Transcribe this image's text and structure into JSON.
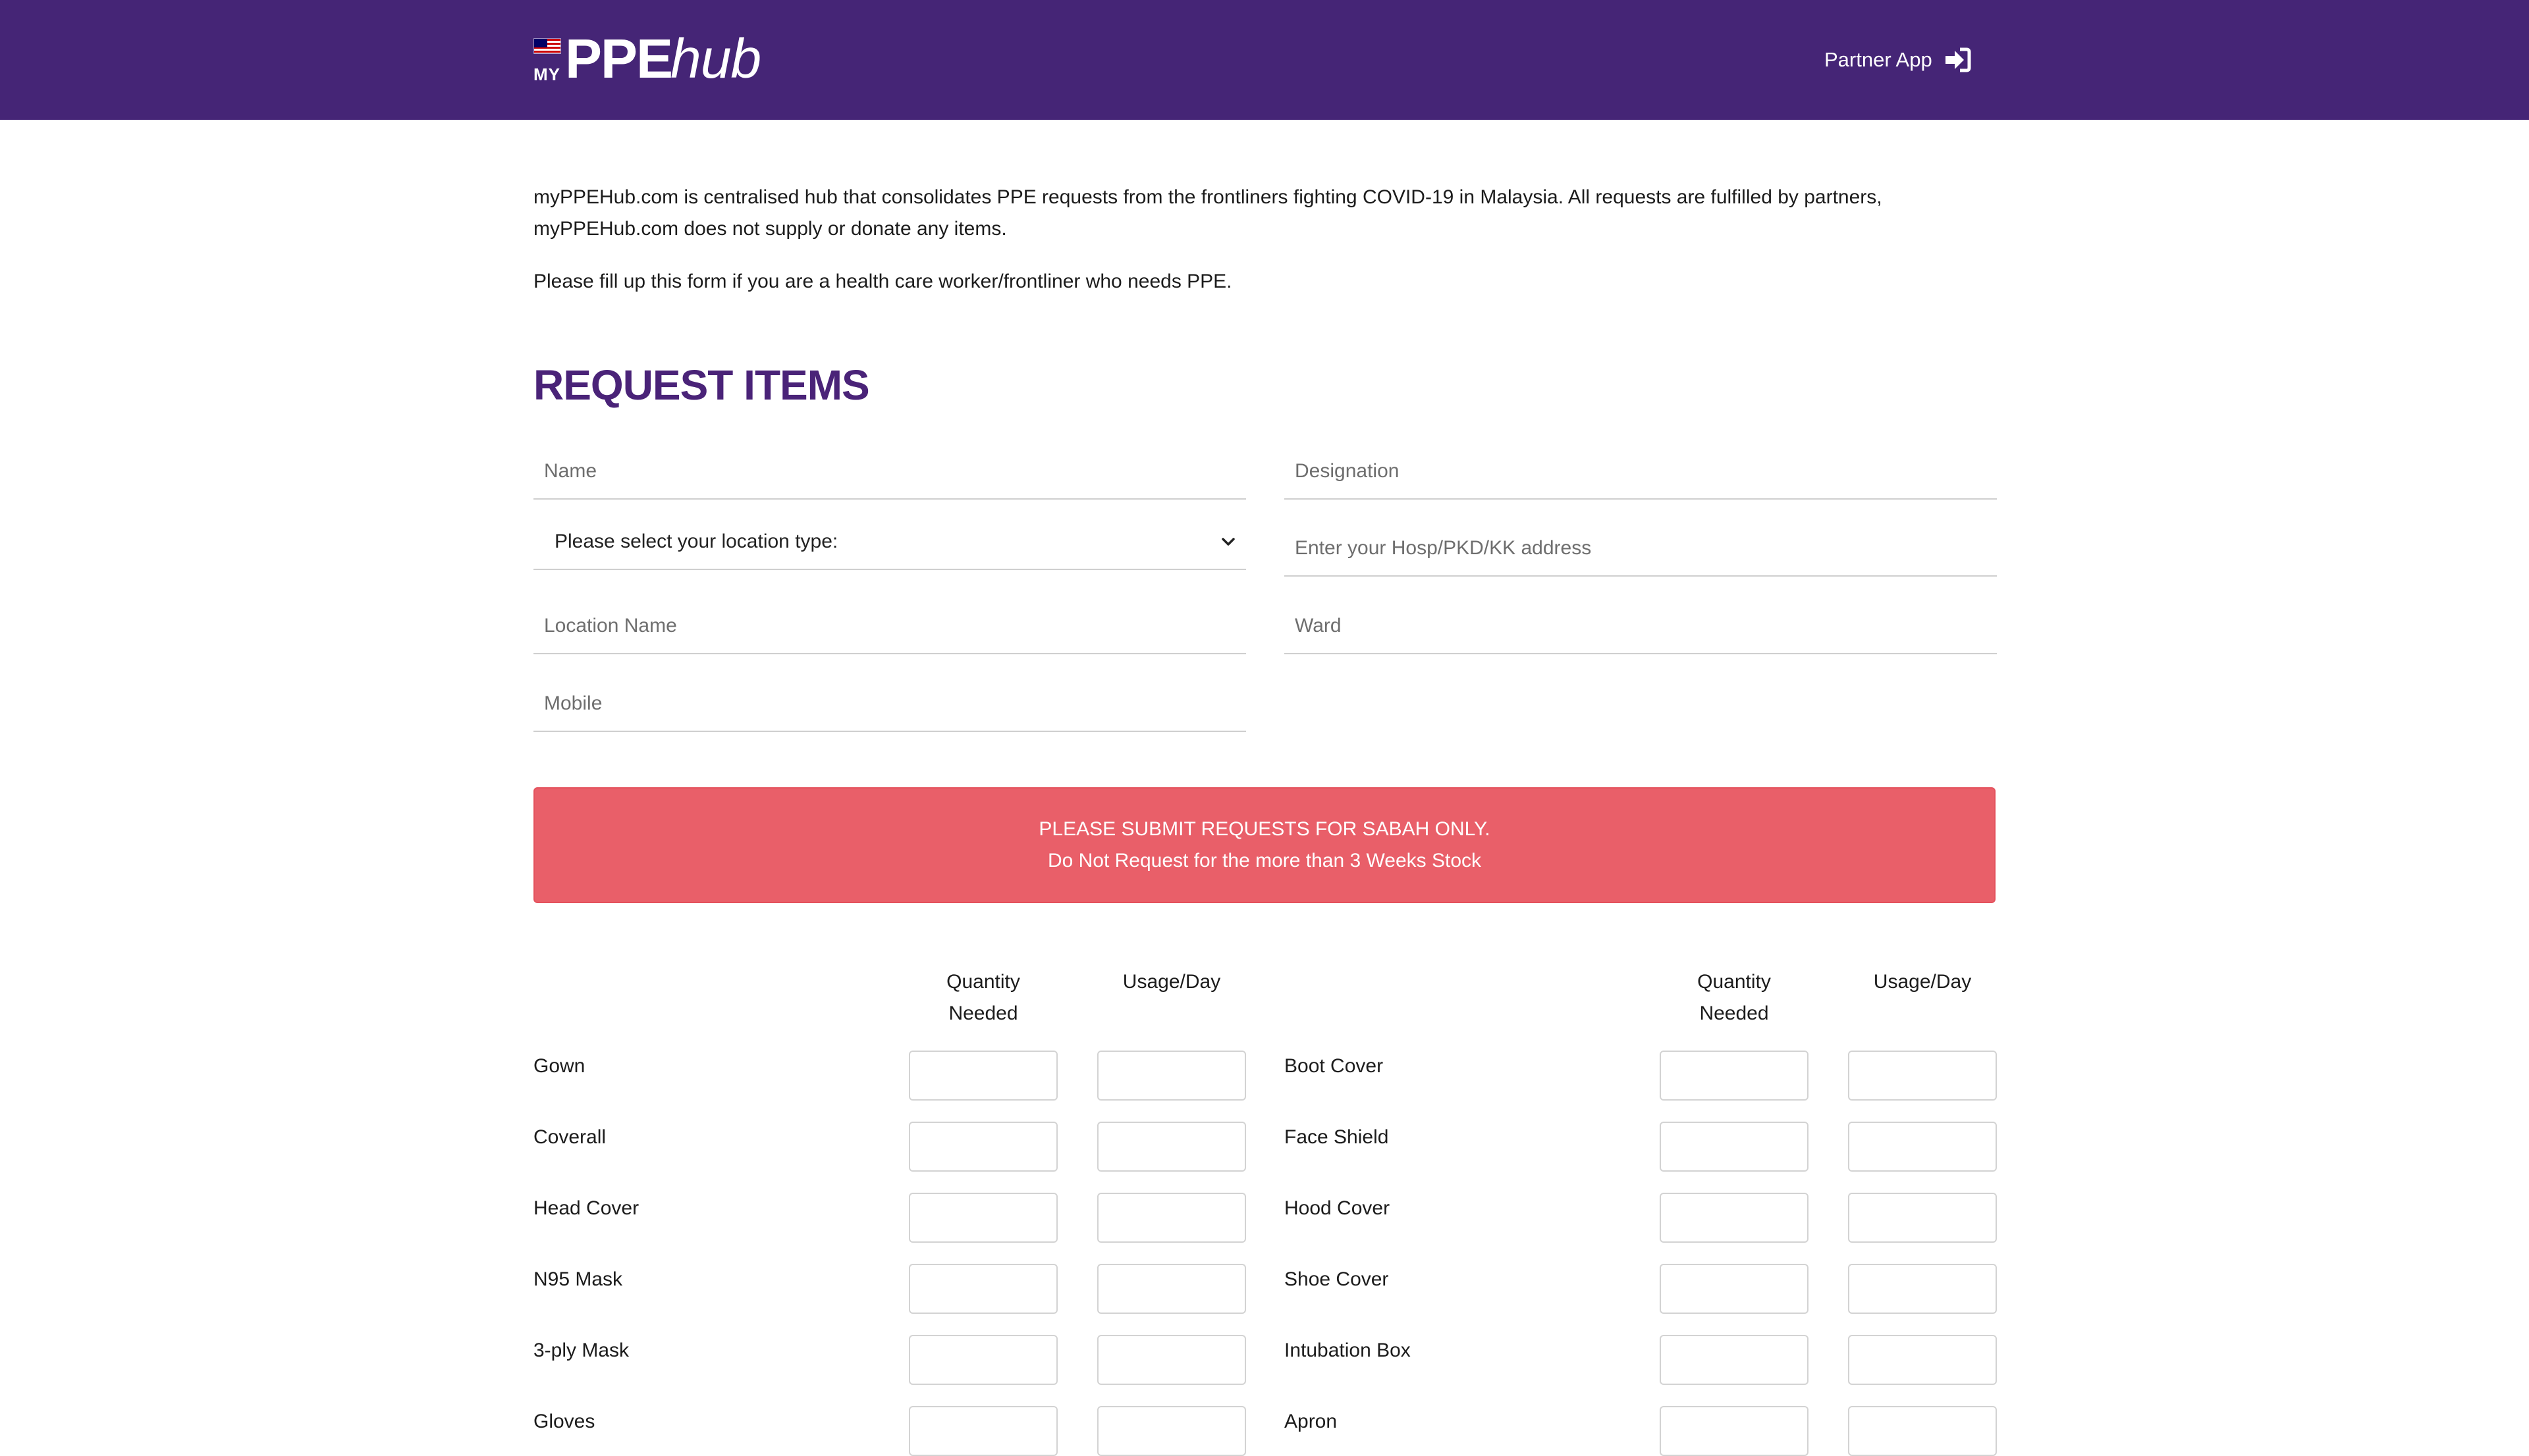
{
  "header": {
    "logo_my": "MY",
    "logo_ppe": "PPE",
    "logo_hub": "hub",
    "partner_label": "Partner App",
    "partner_icon": "sign-in-icon",
    "brand_color": "#452576"
  },
  "intro": {
    "paragraph_1": "myPPEHub.com is centralised hub that consolidates PPE requests from the frontliners fighting COVID-19 in Malaysia. All requests are fulfilled by partners, myPPEHub.com does not supply or donate any items.",
    "paragraph_2": "Please fill up this form if you are a health care worker/frontliner who needs PPE."
  },
  "form": {
    "title": "REQUEST ITEMS",
    "name_placeholder": "Name",
    "designation_placeholder": "Designation",
    "location_type_selected": "Please select your location type:",
    "address_placeholder": "Enter your Hosp/PKD/KK address",
    "location_name_placeholder": "Location Name",
    "ward_placeholder": "Ward",
    "mobile_placeholder": "Mobile"
  },
  "alert": {
    "line_1": "PLEASE SUBMIT REQUESTS FOR SABAH ONLY.",
    "line_2": "Do Not Request for the more than 3 Weeks Stock",
    "color": "#e95f69"
  },
  "items_table": {
    "quantity_line_1": "Quantity",
    "quantity_line_2": "Needed",
    "usage_header": "Usage/Day",
    "left_items": [
      "Gown",
      "Coverall",
      "Head Cover",
      "N95 Mask",
      "3-ply Mask",
      "Gloves"
    ],
    "right_items": [
      "Boot Cover",
      "Face Shield",
      "Hood Cover",
      "Shoe Cover",
      "Intubation Box",
      "Apron"
    ]
  }
}
